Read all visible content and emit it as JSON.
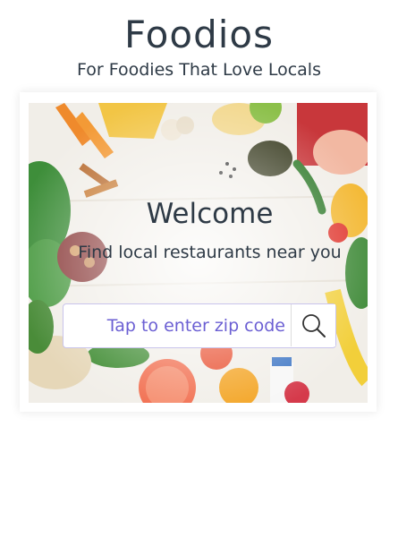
{
  "app": {
    "title": "Foodios",
    "tagline": "For Foodies That Love Locals"
  },
  "hero": {
    "image_icon": "fresh-produce-background",
    "welcome": "Welcome",
    "subtitle": "Find local restaurants near you",
    "zip_placeholder": "Tap to enter zip code",
    "zip_value": "",
    "search_icon": "search-icon"
  },
  "colors": {
    "text_dark": "#2e3a46",
    "accent_purple": "#6b5fd3",
    "input_border": "#c9c4ec"
  }
}
